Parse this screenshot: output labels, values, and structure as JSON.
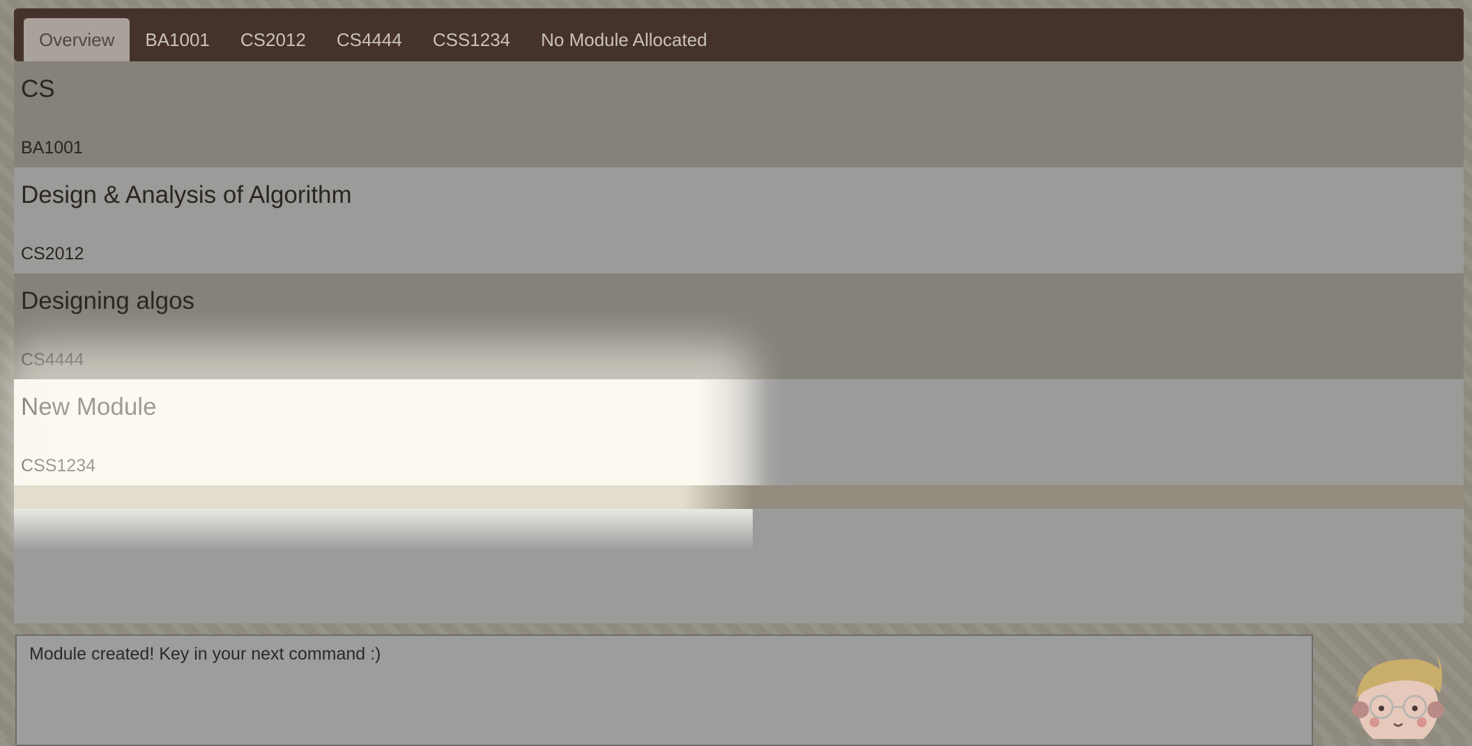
{
  "tabs": [
    {
      "label": "Overview",
      "active": true
    },
    {
      "label": "BA1001"
    },
    {
      "label": "CS2012"
    },
    {
      "label": "CS4444"
    },
    {
      "label": "CSS1234"
    },
    {
      "label": "No Module Allocated"
    }
  ],
  "modules": [
    {
      "name": "CS",
      "code": "BA1001"
    },
    {
      "name": "Design & Analysis of Algorithm",
      "code": "CS2012"
    },
    {
      "name": "Designing algos",
      "code": "CS4444"
    },
    {
      "name": "New Module",
      "code": "CSS1234"
    }
  ],
  "result_display": {
    "text": "Module created! Key in your next command :)"
  },
  "mascot": {
    "icon": "cartoon-boy-with-glasses-icon"
  }
}
